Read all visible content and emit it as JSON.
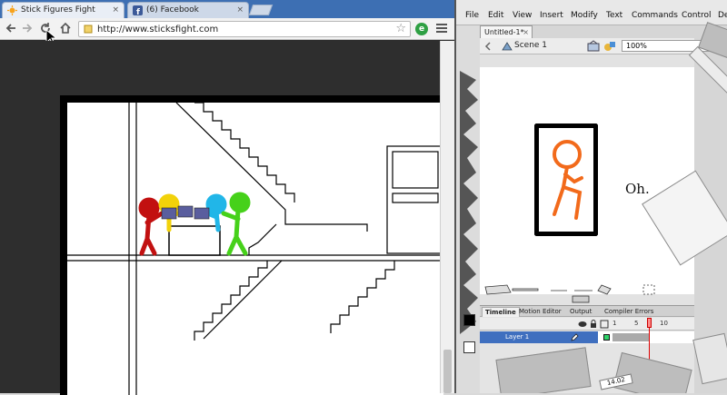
{
  "browser": {
    "tabs": [
      {
        "title": "Stick Figures Fight",
        "active": true
      },
      {
        "title": "(6) Facebook",
        "active": false
      }
    ],
    "tab_close_glyph": "×",
    "nav": {
      "back_icon": "arrow-left-icon",
      "forward_icon": "arrow-right-icon",
      "reload_icon": "reload-icon",
      "home_icon": "home-icon"
    },
    "address_value": "http://www.sticksfight.com",
    "colors": {
      "tabstrip": "#3d6fb3",
      "chrome_bg": "#2e2e2e"
    }
  },
  "flash": {
    "menu": [
      "File",
      "Edit",
      "View",
      "Insert",
      "Modify",
      "Text",
      "Commands",
      "Control",
      "De"
    ],
    "document_tab": "Untitled-1*",
    "document_tab_close": "×",
    "scene_label": "Scene 1",
    "zoom": "100%",
    "stage_text": "Oh.",
    "timeline": {
      "tabs": [
        "Timeline",
        "Motion Editor",
        "Output",
        "Compiler Errors"
      ],
      "frame_numbers": [
        "1",
        "5",
        "10"
      ],
      "layer_name": "Layer 1",
      "frame_counter": "14.02"
    }
  }
}
